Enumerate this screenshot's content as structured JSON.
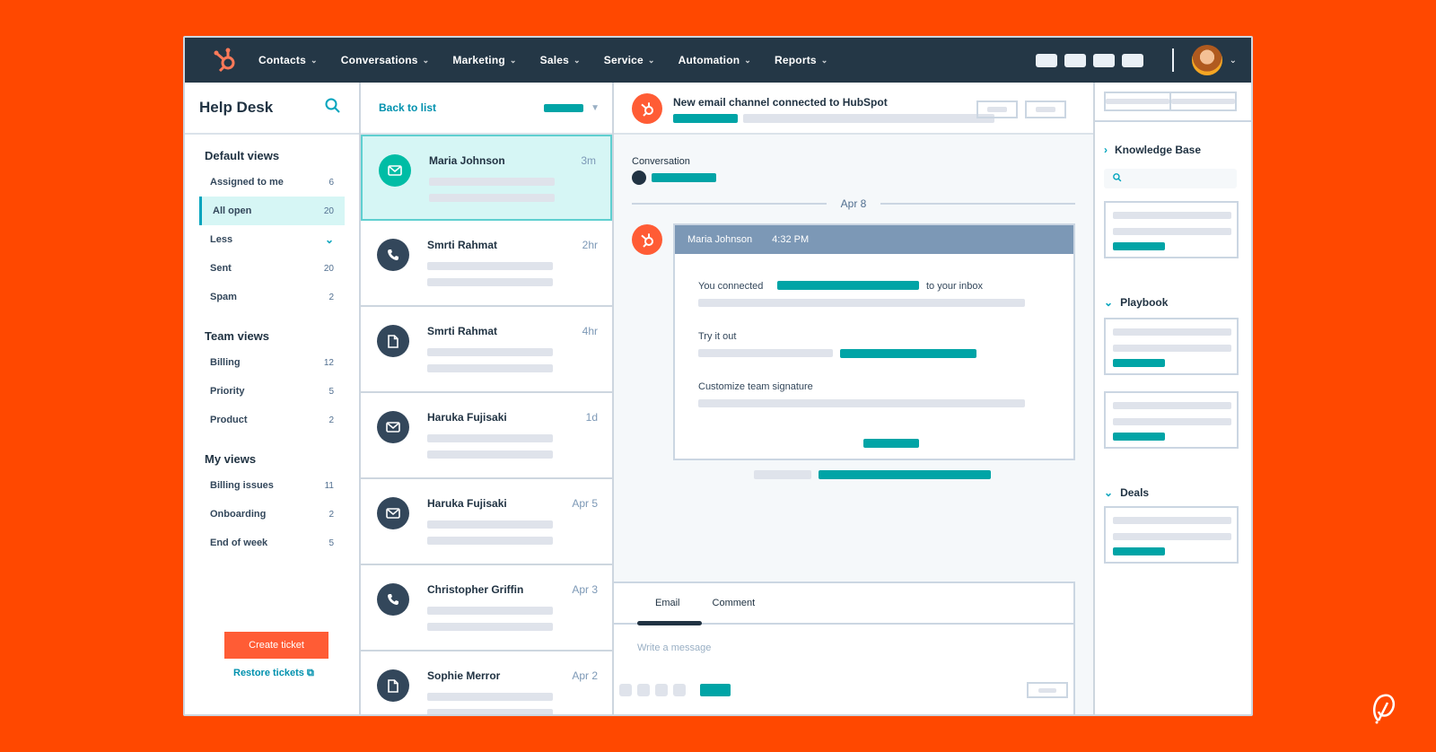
{
  "nav": {
    "items": [
      "Contacts",
      "Conversations",
      "Marketing",
      "Sales",
      "Service",
      "Automation",
      "Reports"
    ]
  },
  "sidebar": {
    "title": "Help Desk",
    "sections": [
      {
        "title": "Default views",
        "items": [
          {
            "label": "Assigned to me",
            "count": "6"
          },
          {
            "label": "All open",
            "count": "20",
            "active": true
          },
          {
            "label": "Less",
            "count": "",
            "chevron": true
          },
          {
            "label": "Sent",
            "count": "20"
          },
          {
            "label": "Spam",
            "count": "2"
          }
        ]
      },
      {
        "title": "Team views",
        "items": [
          {
            "label": "Billing",
            "count": "12"
          },
          {
            "label": "Priority",
            "count": "5"
          },
          {
            "label": "Product",
            "count": "2"
          }
        ]
      },
      {
        "title": "My views",
        "items": [
          {
            "label": "Billing issues",
            "count": "11"
          },
          {
            "label": "Onboarding",
            "count": "2"
          },
          {
            "label": "End of week",
            "count": "5"
          }
        ]
      }
    ],
    "create_label": "Create ticket",
    "restore_label": "Restore tickets"
  },
  "list": {
    "back_label": "Back to list",
    "items": [
      {
        "name": "Maria Johnson",
        "time": "3m",
        "icon": "email-icon",
        "active": true
      },
      {
        "name": "Smrti Rahmat",
        "time": "2hr",
        "icon": "phone-icon"
      },
      {
        "name": "Smrti Rahmat",
        "time": "4hr",
        "icon": "document-icon"
      },
      {
        "name": "Haruka Fujisaki",
        "time": "1d",
        "icon": "email-icon"
      },
      {
        "name": "Haruka Fujisaki",
        "time": "Apr 5",
        "icon": "email-icon"
      },
      {
        "name": "Christopher Griffin",
        "time": "Apr 3",
        "icon": "phone-icon"
      },
      {
        "name": "Sophie Merror",
        "time": "Apr 2",
        "icon": "document-icon"
      }
    ]
  },
  "main": {
    "header_title": "New email channel connected to HubSpot",
    "conversation_label": "Conversation",
    "date": "Apr 8",
    "message": {
      "sender": "Maria Johnson",
      "time": "4:32 PM",
      "line1_a": "You connected",
      "line1_b": "to your inbox",
      "line2": "Try it out",
      "line3": "Customize team signature"
    },
    "composer": {
      "tabs": [
        "Email",
        "Comment"
      ],
      "placeholder": "Write a message"
    }
  },
  "right": {
    "sections": [
      "Knowledge Base",
      "Playbook",
      "Deals"
    ]
  },
  "colors": {
    "brand": "#ff4800",
    "teal": "#00a4a6",
    "navy": "#243746"
  }
}
